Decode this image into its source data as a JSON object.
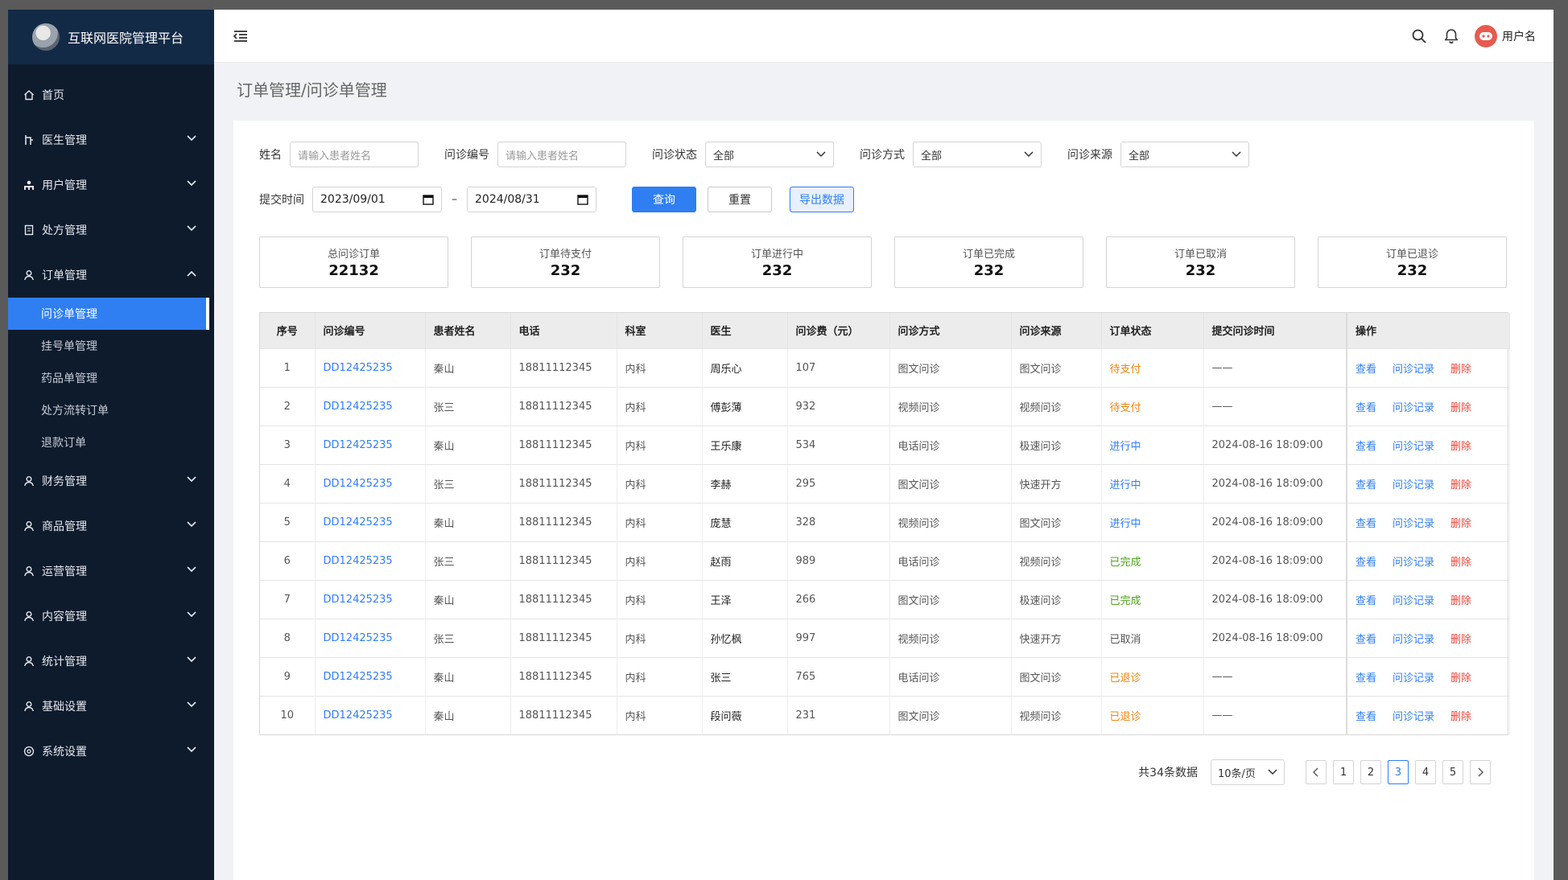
{
  "app": {
    "title": "互联网医院管理平台"
  },
  "sidebar": {
    "items": [
      {
        "label": "首页",
        "icon": "home-icon",
        "expandable": false
      },
      {
        "label": "医生管理",
        "icon": "doctor-icon",
        "expandable": true
      },
      {
        "label": "用户管理",
        "icon": "users-icon",
        "expandable": true
      },
      {
        "label": "处方管理",
        "icon": "document-icon",
        "expandable": true
      },
      {
        "label": "订单管理",
        "icon": "user-icon",
        "expandable": true,
        "expanded": true,
        "children": [
          "问诊单管理",
          "挂号单管理",
          "药品单管理",
          "处方流转订单",
          "退款订单"
        ],
        "active_child": 0
      },
      {
        "label": "财务管理",
        "icon": "user-icon",
        "expandable": true
      },
      {
        "label": "商品管理",
        "icon": "user-icon",
        "expandable": true
      },
      {
        "label": "运营管理",
        "icon": "user-icon",
        "expandable": true
      },
      {
        "label": "内容管理",
        "icon": "user-icon",
        "expandable": true
      },
      {
        "label": "统计管理",
        "icon": "user-icon",
        "expandable": true
      },
      {
        "label": "基础设置",
        "icon": "user-icon",
        "expandable": true
      },
      {
        "label": "系统设置",
        "icon": "settings-icon",
        "expandable": true
      }
    ]
  },
  "topbar": {
    "username": "用户名"
  },
  "page": {
    "title": "订单管理/问诊单管理"
  },
  "filters": {
    "name_label": "姓名",
    "name_placeholder": "请输入患者姓名",
    "code_label": "问诊编号",
    "code_placeholder": "请输入患者姓名",
    "status_label": "问诊状态",
    "status_value": "全部",
    "method_label": "问诊方式",
    "method_value": "全部",
    "source_label": "问诊来源",
    "source_value": "全部",
    "time_label": "提交时间",
    "date_from": "2023/09/01",
    "date_sep": "–",
    "date_to": "2024/08/31",
    "query_btn": "查询",
    "reset_btn": "重置",
    "export_btn": "导出数据"
  },
  "stats": [
    {
      "label": "总问诊订单",
      "value": "22132"
    },
    {
      "label": "订单待支付",
      "value": "232"
    },
    {
      "label": "订单进行中",
      "value": "232"
    },
    {
      "label": "订单已完成",
      "value": "232"
    },
    {
      "label": "订单已取消",
      "value": "232"
    },
    {
      "label": "订单已退诊",
      "value": "232"
    }
  ],
  "table": {
    "headers": [
      "序号",
      "问诊编号",
      "患者姓名",
      "电话",
      "科室",
      "医生",
      "问诊费（元）",
      "问诊方式",
      "问诊来源",
      "订单状态",
      "提交问诊时间",
      "操作"
    ],
    "actions": [
      "查看",
      "问诊记录",
      "删除"
    ],
    "rows": [
      {
        "no": "1",
        "code": "DD12425235",
        "patient": "秦山",
        "phone": "18811112345",
        "dept": "内科",
        "doctor": "周乐心",
        "fee": "107",
        "method": "图文问诊",
        "source": "图文问诊",
        "status": "待支付",
        "status_color": "#f0860a",
        "time": "——"
      },
      {
        "no": "2",
        "code": "DD12425235",
        "patient": "张三",
        "phone": "18811112345",
        "dept": "内科",
        "doctor": "傅彭薄",
        "fee": "932",
        "method": "视频问诊",
        "source": "视频问诊",
        "status": "待支付",
        "status_color": "#f0860a",
        "time": "——"
      },
      {
        "no": "3",
        "code": "DD12425235",
        "patient": "秦山",
        "phone": "18811112345",
        "dept": "内科",
        "doctor": "王乐康",
        "fee": "534",
        "method": "电话问诊",
        "source": "极速问诊",
        "status": "进行中",
        "status_color": "#2f7ff2",
        "time": "2024-08-16 18:09:00"
      },
      {
        "no": "4",
        "code": "DD12425235",
        "patient": "张三",
        "phone": "18811112345",
        "dept": "内科",
        "doctor": "李赫",
        "fee": "295",
        "method": "图文问诊",
        "source": "快速开方",
        "status": "进行中",
        "status_color": "#2f7ff2",
        "time": "2024-08-16 18:09:00"
      },
      {
        "no": "5",
        "code": "DD12425235",
        "patient": "秦山",
        "phone": "18811112345",
        "dept": "内科",
        "doctor": "庞慧",
        "fee": "328",
        "method": "视频问诊",
        "source": "图文问诊",
        "status": "进行中",
        "status_color": "#2f7ff2",
        "time": "2024-08-16 18:09:00"
      },
      {
        "no": "6",
        "code": "DD12425235",
        "patient": "张三",
        "phone": "18811112345",
        "dept": "内科",
        "doctor": "赵雨",
        "fee": "989",
        "method": "电话问诊",
        "source": "视频问诊",
        "status": "已完成",
        "status_color": "#4ea41c",
        "time": "2024-08-16 18:09:00"
      },
      {
        "no": "7",
        "code": "DD12425235",
        "patient": "秦山",
        "phone": "18811112345",
        "dept": "内科",
        "doctor": "王泽",
        "fee": "266",
        "method": "图文问诊",
        "source": "极速问诊",
        "status": "已完成",
        "status_color": "#4ea41c",
        "time": "2024-08-16 18:09:00"
      },
      {
        "no": "8",
        "code": "DD12425235",
        "patient": "张三",
        "phone": "18811112345",
        "dept": "内科",
        "doctor": "孙忆枫",
        "fee": "997",
        "method": "视频问诊",
        "source": "快速开方",
        "status": "已取消",
        "status_color": "#555555",
        "time": "2024-08-16 18:09:00"
      },
      {
        "no": "9",
        "code": "DD12425235",
        "patient": "秦山",
        "phone": "18811112345",
        "dept": "内科",
        "doctor": "张三",
        "fee": "765",
        "method": "电话问诊",
        "source": "图文问诊",
        "status": "已退诊",
        "status_color": "#f0860a",
        "time": "——"
      },
      {
        "no": "10",
        "code": "DD12425235",
        "patient": "秦山",
        "phone": "18811112345",
        "dept": "内科",
        "doctor": "段问薇",
        "fee": "231",
        "method": "图文问诊",
        "source": "视频问诊",
        "status": "已退诊",
        "status_color": "#f0860a",
        "time": "——"
      }
    ]
  },
  "pagination": {
    "total_text": "共34条数据",
    "page_size": "10条/页",
    "pages": [
      "1",
      "2",
      "3",
      "4",
      "5"
    ],
    "current": "3"
  }
}
